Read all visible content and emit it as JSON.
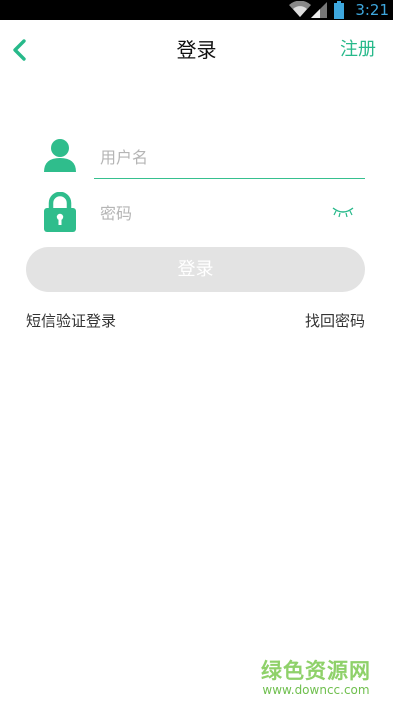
{
  "status_bar": {
    "time": "3:21",
    "icons": [
      "wifi-icon",
      "signal-icon",
      "battery-icon"
    ]
  },
  "nav": {
    "back_icon": "chevron-left-icon",
    "title": "登录",
    "register": "注册"
  },
  "form": {
    "username_placeholder": "用户名",
    "password_placeholder": "密码",
    "user_icon": "user-icon",
    "lock_icon": "lock-icon",
    "toggle_icon": "eye-closed-icon"
  },
  "login_button": "登录",
  "links": {
    "sms_login": "短信验证登录",
    "recover_password": "找回密码"
  },
  "watermark": {
    "title": "绿色资源网",
    "url": "www.downcc.com"
  },
  "colors": {
    "accent": "#27b98a",
    "button_disabled": "#e3e3e3",
    "status_bar": "#000000",
    "status_text": "#3ea7dd"
  }
}
